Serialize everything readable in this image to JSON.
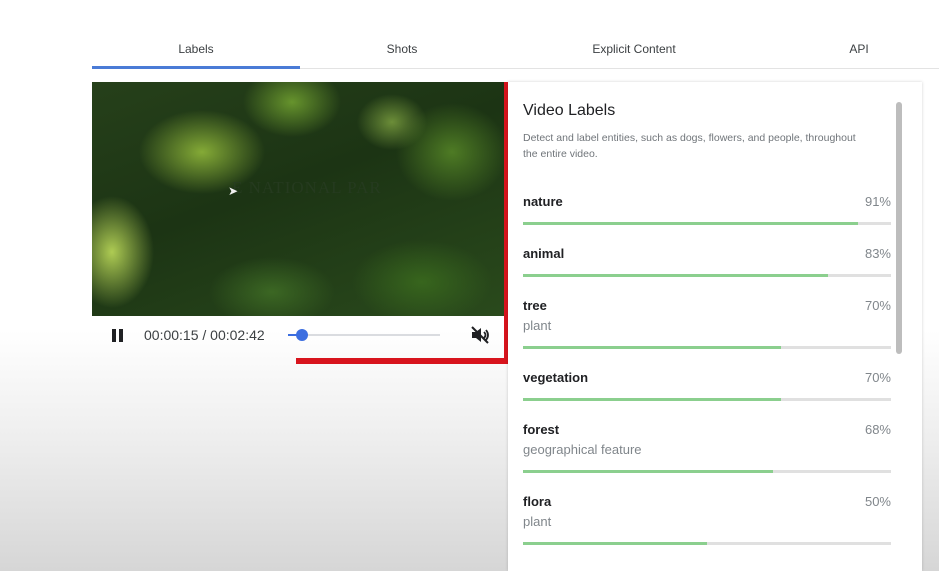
{
  "tabs": [
    {
      "label": "Labels",
      "active": true
    },
    {
      "label": "Shots",
      "active": false
    },
    {
      "label": "Explicit Content",
      "active": false
    },
    {
      "label": "API",
      "active": false
    }
  ],
  "video": {
    "overlay_text": "E NATIONAL PAR",
    "current_time": "00:00:15",
    "separator": " / ",
    "duration": "00:02:42",
    "progress": 0.09,
    "muted": true
  },
  "panel": {
    "title": "Video Labels",
    "description": "Detect and label entities, such as dogs, flowers, and people, throughout the entire video.",
    "labels": [
      {
        "name": "nature",
        "category": "",
        "percent": "91%",
        "confidence": 0.91
      },
      {
        "name": "animal",
        "category": "",
        "percent": "83%",
        "confidence": 0.83
      },
      {
        "name": "tree",
        "category": "plant",
        "percent": "70%",
        "confidence": 0.7
      },
      {
        "name": "vegetation",
        "category": "",
        "percent": "70%",
        "confidence": 0.7
      },
      {
        "name": "forest",
        "category": "geographical feature",
        "percent": "68%",
        "confidence": 0.68
      },
      {
        "name": "flora",
        "category": "plant",
        "percent": "50%",
        "confidence": 0.5
      }
    ]
  },
  "colors": {
    "accent": "#4a7bd6",
    "bar_fill": "#8bcf8e",
    "highlight": "#d8141d"
  },
  "icons": {
    "play_state": "pause-icon",
    "volume": "volume-muted-icon"
  }
}
